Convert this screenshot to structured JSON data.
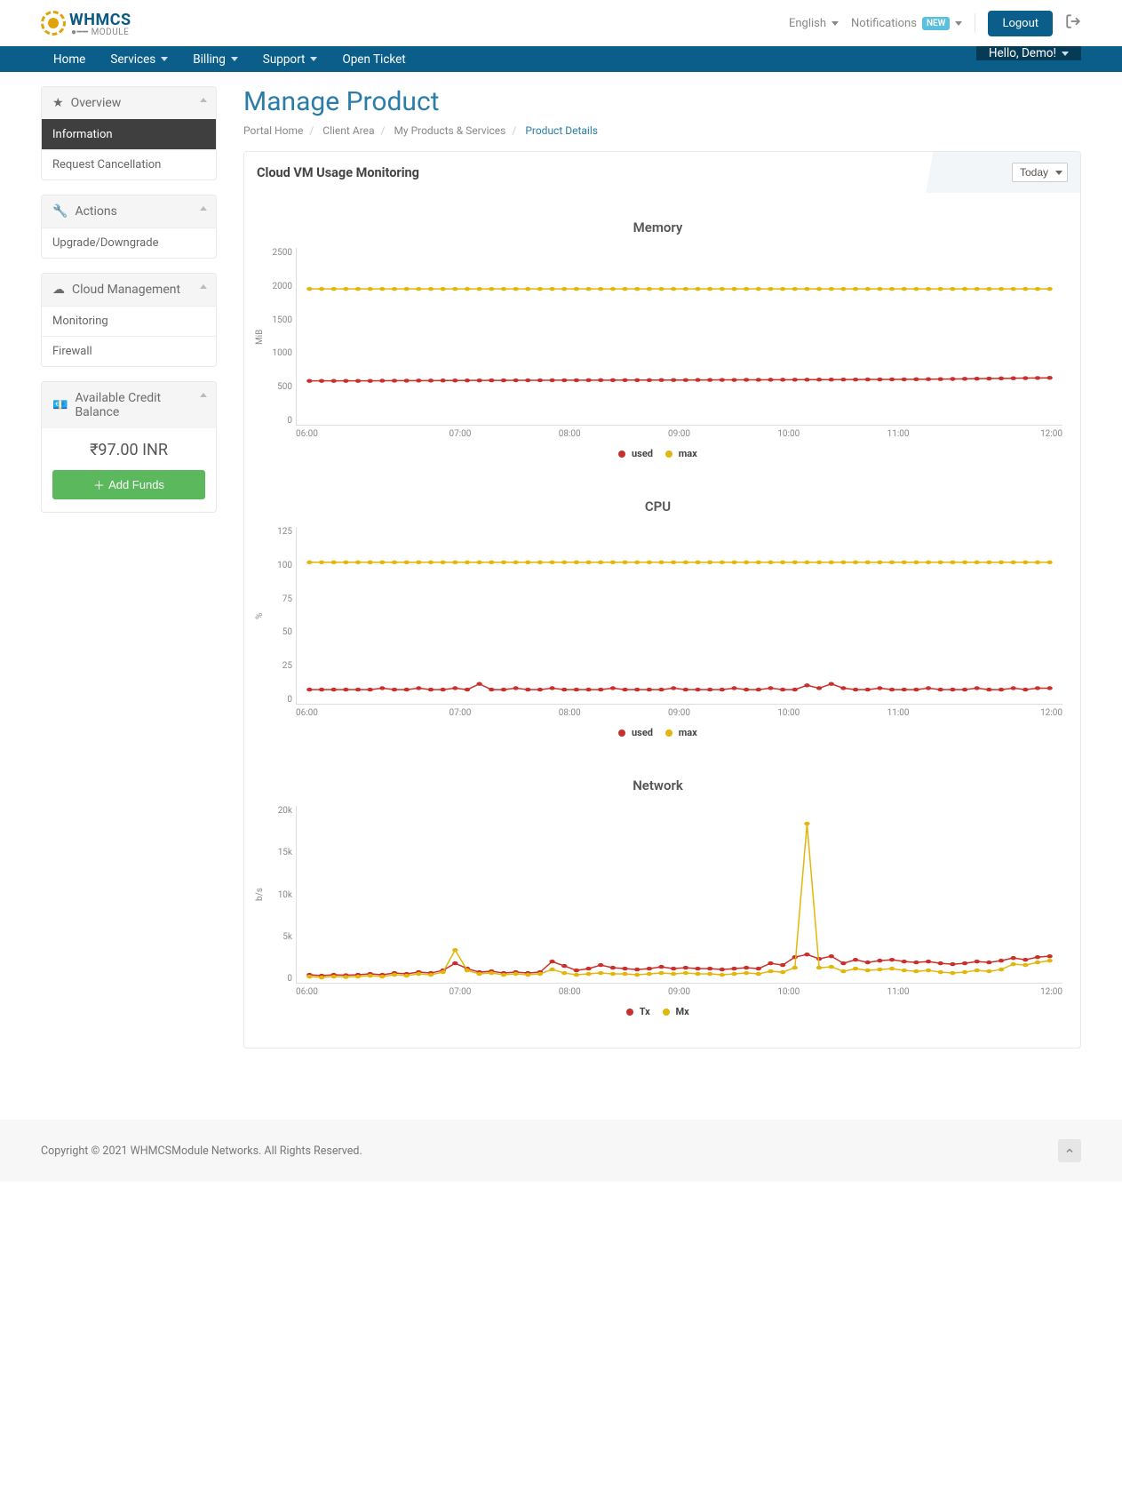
{
  "logo_text": "WHMCS",
  "logo_sub": "MODULE",
  "top": {
    "language": "English",
    "notifications": "Notifications",
    "notifications_badge": "NEW",
    "logout": "Logout"
  },
  "nav": {
    "home": "Home",
    "services": "Services",
    "billing": "Billing",
    "support": "Support",
    "open_ticket": "Open Ticket",
    "hello": "Hello, Demo!"
  },
  "sidebar": {
    "overview": {
      "title": "Overview",
      "items": [
        "Information",
        "Request Cancellation"
      ]
    },
    "actions": {
      "title": "Actions",
      "items": [
        "Upgrade/Downgrade"
      ]
    },
    "cloud": {
      "title": "Cloud Management",
      "items": [
        "Monitoring",
        "Firewall"
      ]
    },
    "balance": {
      "title": "Available Credit Balance",
      "amount": "₹97.00 INR",
      "button": "Add Funds"
    }
  },
  "page": {
    "title": "Manage Product",
    "breadcrumb": [
      "Portal Home",
      "Client Area",
      "My Products & Services",
      "Product Details"
    ]
  },
  "card": {
    "title": "Cloud VM Usage Monitoring",
    "period": "Today"
  },
  "colors": {
    "used": "#c9302c",
    "max": "#e2b70a"
  },
  "chart_data": [
    {
      "name": "Memory",
      "type": "line",
      "ylabel": "MiB",
      "yticks": [
        "2500",
        "2000",
        "1500",
        "1000",
        "500",
        "0"
      ],
      "ylim": [
        0,
        2500
      ],
      "xticks": [
        "06:00",
        "07:00",
        "08:00",
        "09:00",
        "10:00",
        "11:00",
        "12:00"
      ],
      "x_count": 62,
      "series": [
        {
          "name": "used",
          "color": "#c9302c",
          "values": [
            620,
            620,
            620,
            620,
            620,
            620,
            622,
            623,
            623,
            624,
            624,
            625,
            625,
            626,
            626,
            627,
            627,
            628,
            628,
            628,
            629,
            629,
            629,
            630,
            630,
            630,
            631,
            631,
            631,
            632,
            632,
            632,
            633,
            633,
            634,
            634,
            635,
            635,
            636,
            636,
            637,
            637,
            638,
            638,
            639,
            639,
            640,
            640,
            641,
            642,
            643,
            644,
            645,
            647,
            649,
            651,
            653,
            655,
            657,
            659,
            661,
            663
          ]
        },
        {
          "name": "max",
          "color": "#e2b70a",
          "values": [
            1920,
            1920,
            1920,
            1920,
            1920,
            1920,
            1920,
            1920,
            1920,
            1920,
            1920,
            1920,
            1920,
            1920,
            1920,
            1920,
            1920,
            1920,
            1920,
            1920,
            1920,
            1920,
            1920,
            1920,
            1920,
            1920,
            1920,
            1920,
            1920,
            1920,
            1920,
            1920,
            1920,
            1920,
            1920,
            1920,
            1920,
            1920,
            1920,
            1920,
            1920,
            1920,
            1920,
            1920,
            1920,
            1920,
            1920,
            1920,
            1920,
            1920,
            1920,
            1920,
            1920,
            1920,
            1920,
            1920,
            1920,
            1920,
            1920,
            1920,
            1920,
            1920
          ]
        }
      ],
      "legend": [
        "used",
        "max"
      ]
    },
    {
      "name": "CPU",
      "type": "line",
      "ylabel": "%",
      "yticks": [
        "125",
        "100",
        "75",
        "50",
        "25",
        "0"
      ],
      "ylim": [
        0,
        125
      ],
      "xticks": [
        "06:00",
        "07:00",
        "08:00",
        "09:00",
        "10:00",
        "11:00",
        "12:00"
      ],
      "x_count": 62,
      "series": [
        {
          "name": "used",
          "color": "#c9302c",
          "values": [
            10,
            10,
            10,
            10,
            10,
            10,
            11,
            10,
            10,
            11,
            10,
            10,
            11,
            10,
            14,
            10,
            10,
            11,
            10,
            10,
            11,
            10,
            10,
            10,
            10,
            11,
            10,
            10,
            10,
            10,
            11,
            10,
            10,
            10,
            10,
            11,
            10,
            10,
            11,
            10,
            10,
            13,
            11,
            14,
            11,
            10,
            10,
            11,
            10,
            10,
            10,
            11,
            10,
            10,
            10,
            11,
            10,
            10,
            11,
            10,
            11,
            11
          ]
        },
        {
          "name": "max",
          "color": "#e2b70a",
          "values": [
            100,
            100,
            100,
            100,
            100,
            100,
            100,
            100,
            100,
            100,
            100,
            100,
            100,
            100,
            100,
            100,
            100,
            100,
            100,
            100,
            100,
            100,
            100,
            100,
            100,
            100,
            100,
            100,
            100,
            100,
            100,
            100,
            100,
            100,
            100,
            100,
            100,
            100,
            100,
            100,
            100,
            100,
            100,
            100,
            100,
            100,
            100,
            100,
            100,
            100,
            100,
            100,
            100,
            100,
            100,
            100,
            100,
            100,
            100,
            100,
            100,
            100
          ]
        }
      ],
      "legend": [
        "used",
        "max"
      ]
    },
    {
      "name": "Network",
      "type": "line",
      "ylabel": "b/s",
      "yticks": [
        "20k",
        "15k",
        "10k",
        "5k",
        "0"
      ],
      "ylim": [
        0,
        20000
      ],
      "xticks": [
        "06:00",
        "07:00",
        "08:00",
        "09:00",
        "10:00",
        "11:00",
        "12:00"
      ],
      "x_count": 62,
      "series": [
        {
          "name": "Tx",
          "color": "#c9302c",
          "values": [
            900,
            800,
            900,
            850,
            900,
            1000,
            900,
            1100,
            1000,
            1200,
            1100,
            1400,
            2200,
            1600,
            1200,
            1300,
            1100,
            1200,
            1100,
            1200,
            2400,
            1900,
            1400,
            1600,
            2000,
            1700,
            1600,
            1500,
            1600,
            1800,
            1600,
            1700,
            1600,
            1600,
            1500,
            1600,
            1700,
            1600,
            2200,
            2000,
            2900,
            3200,
            2700,
            3000,
            2200,
            2600,
            2300,
            2500,
            2600,
            2400,
            2300,
            2400,
            2200,
            2100,
            2200,
            2400,
            2300,
            2500,
            2800,
            2600,
            2900,
            3000
          ]
        },
        {
          "name": "Mx",
          "color": "#e2b70a",
          "values": [
            700,
            600,
            700,
            650,
            700,
            800,
            700,
            900,
            800,
            1000,
            900,
            1200,
            3700,
            1400,
            1000,
            1100,
            900,
            1000,
            900,
            1000,
            1500,
            1100,
            900,
            1000,
            1100,
            1000,
            1000,
            900,
            1000,
            1100,
            1000,
            1100,
            1000,
            1000,
            900,
            1000,
            1100,
            1000,
            1300,
            1200,
            1700,
            18000,
            1700,
            1800,
            1300,
            1600,
            1400,
            1500,
            1600,
            1400,
            1300,
            1400,
            1200,
            1100,
            1200,
            1400,
            1300,
            1500,
            2100,
            2000,
            2300,
            2500
          ]
        }
      ],
      "legend": [
        "Tx",
        "Mx"
      ]
    }
  ],
  "footer": "Copyright © 2021 WHMCSModule Networks. All Rights Reserved."
}
